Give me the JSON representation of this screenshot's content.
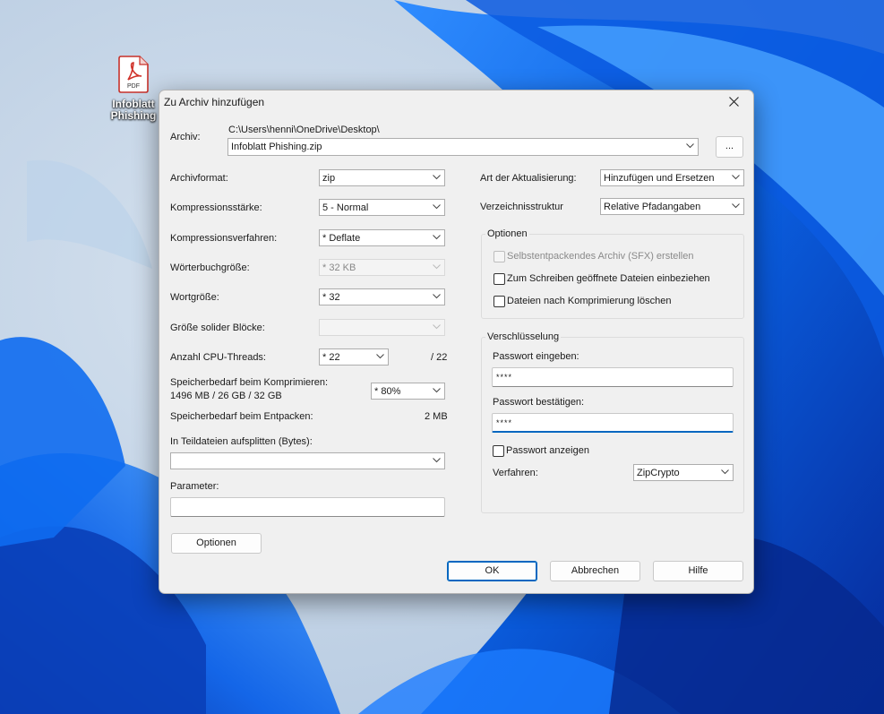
{
  "desktop": {
    "icon_label_line1": "Infoblatt",
    "icon_label_line2": "Phishing",
    "pdf_badge": "PDF"
  },
  "dialog": {
    "title": "Zu Archiv hinzufügen",
    "archive_label": "Archiv:",
    "archive_path": "C:\\Users\\henni\\OneDrive\\Desktop\\",
    "archive_name": "Infoblatt Phishing.zip",
    "browse_label": "...",
    "left": {
      "format_label": "Archivformat:",
      "format_value": "zip",
      "level_label": "Kompressionsstärke:",
      "level_value": "5 - Normal",
      "method_label": "Kompressionsverfahren:",
      "method_value": "* Deflate",
      "dict_label": "Wörterbuchgröße:",
      "dict_value": "* 32 KB",
      "word_label": "Wortgröße:",
      "word_value": "* 32",
      "solid_label": "Größe solider Blöcke:",
      "solid_value": "",
      "threads_label": "Anzahl CPU-Threads:",
      "threads_value": "* 22",
      "threads_max": "/ 22",
      "mem_comp_label": "Speicherbedarf beim Komprimieren:",
      "mem_comp_detail": "1496 MB / 26 GB / 32 GB",
      "mem_comp_value": "* 80%",
      "mem_decomp_label": "Speicherbedarf beim Entpacken:",
      "mem_decomp_value": "2 MB",
      "split_label": "In Teildateien aufsplitten (Bytes):",
      "split_value": "",
      "param_label": "Parameter:",
      "param_value": ""
    },
    "right": {
      "update_label": "Art der Aktualisierung:",
      "update_value": "Hinzufügen und Ersetzen",
      "path_label": "Verzeichnisstruktur",
      "path_value": "Relative Pfadangaben",
      "options_title": "Optionen",
      "sfx_label": "Selbstentpackendes Archiv (SFX) erstellen",
      "shared_label": "Zum Schreiben geöffnete Dateien einbeziehen",
      "delete_label": "Dateien nach Komprimierung löschen",
      "encryption_title": "Verschlüsselung",
      "pw_label": "Passwort eingeben:",
      "pw_value": "****",
      "pw2_label": "Passwort bestätigen:",
      "pw2_value": "****",
      "show_pw_label": "Passwort anzeigen",
      "enc_method_label": "Verfahren:",
      "enc_method_value": "ZipCrypto"
    },
    "buttons": {
      "options": "Optionen",
      "ok": "OK",
      "cancel": "Abbrechen",
      "help": "Hilfe"
    }
  }
}
